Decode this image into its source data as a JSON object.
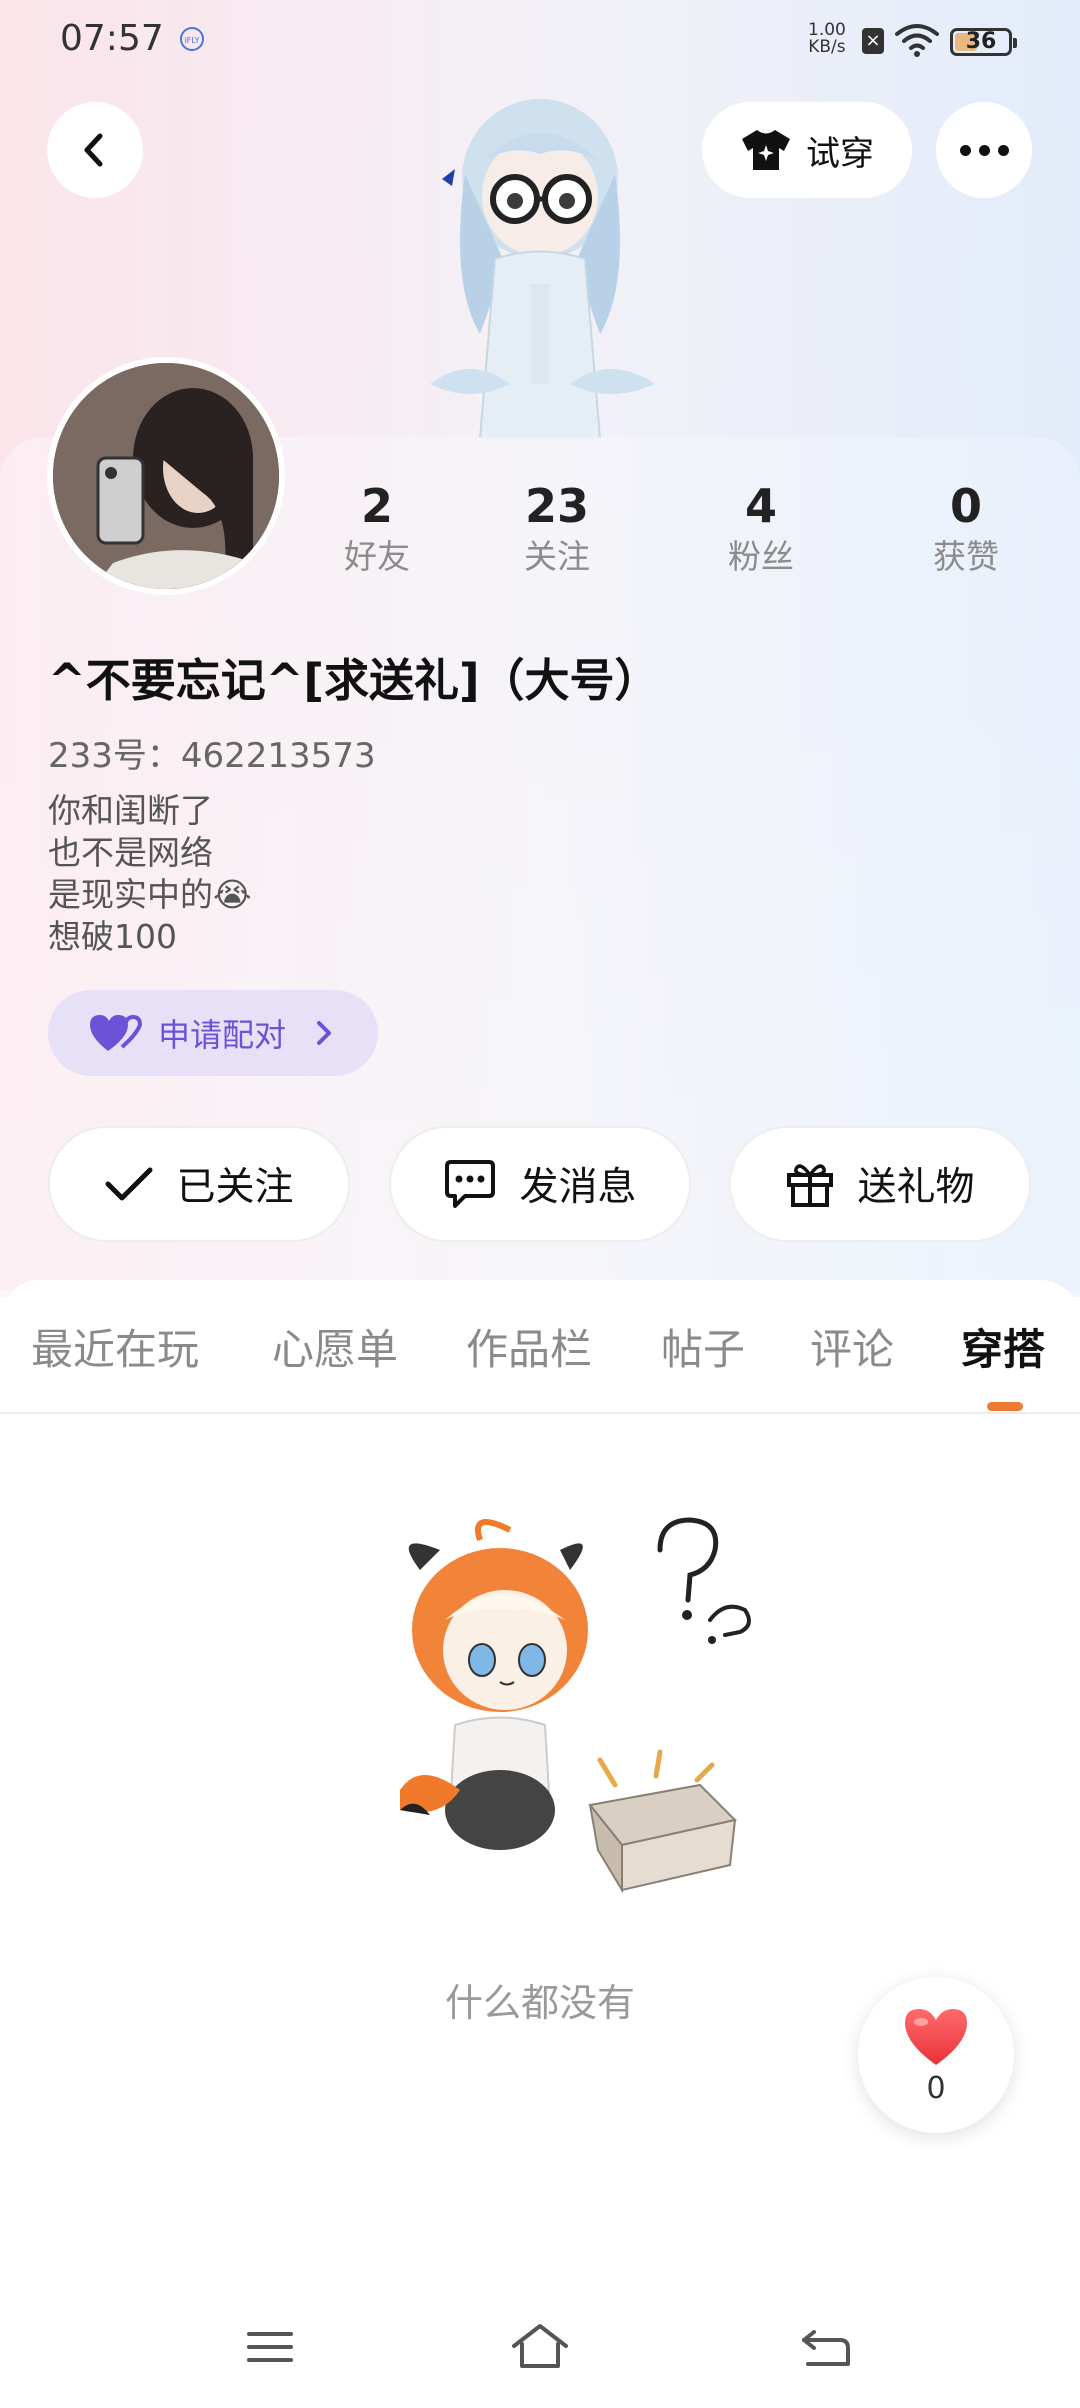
{
  "status_bar": {
    "time": "07:57",
    "network_speed_value": "1.00",
    "network_speed_unit": "KB/s",
    "battery": "36"
  },
  "header": {
    "back_icon": "chevron-left-icon",
    "try_on_label": "试穿",
    "try_on_icon": "tshirt-icon",
    "more_icon": "more-dots-icon"
  },
  "profile": {
    "stats": [
      {
        "value": "2",
        "label": "好友"
      },
      {
        "value": "23",
        "label": "关注"
      },
      {
        "value": "4",
        "label": "粉丝"
      },
      {
        "value": "0",
        "label": "获赞"
      }
    ],
    "username": "^不要忘记^[求送礼]（大号）",
    "uid": "233号：462213573",
    "bio_lines": [
      "你和闺断了",
      "也不是网络",
      "是现实中的😭",
      "想破100"
    ],
    "pair_button_label": "申请配对",
    "pair_color": "#6b52d6"
  },
  "actions": {
    "follow_label": "已关注",
    "message_label": "发消息",
    "gift_label": "送礼物"
  },
  "tabs": {
    "items": [
      "最近在玩",
      "心愿单",
      "作品栏",
      "帖子",
      "评论",
      "穿搭"
    ],
    "active": "穿搭",
    "accent": "#ee7a34"
  },
  "content": {
    "empty_text": "什么都没有"
  },
  "like": {
    "count": "0",
    "color": "#f0454a"
  }
}
